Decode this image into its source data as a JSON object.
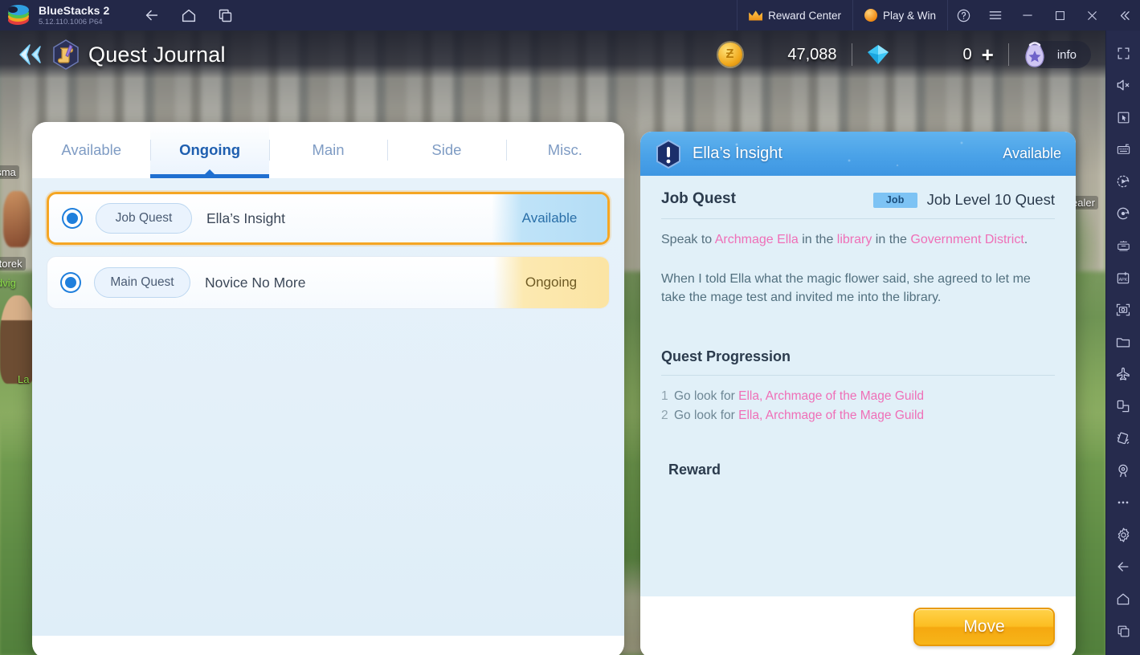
{
  "titlebar": {
    "app_name": "BlueStacks 2",
    "version": "5.12.110.1006  P64",
    "nav": [
      {
        "name": "back-icon",
        "label": "Back"
      },
      {
        "name": "home-icon",
        "label": "Home"
      },
      {
        "name": "multi-instance-icon",
        "label": "Multi-instance"
      }
    ],
    "reward_center": "Reward Center",
    "play_and_win": "Play & Win",
    "window_icons": [
      "help-icon",
      "menu-icon",
      "minimize-icon",
      "maximize-icon",
      "close-icon",
      "collapse-icon"
    ]
  },
  "game_header": {
    "title": "Quest Journal",
    "gold_value": "47,088",
    "gem_value": "0",
    "plus": "+",
    "info_label": "info"
  },
  "quest_list": {
    "tabs": [
      {
        "label": "Available",
        "active": false
      },
      {
        "label": "Ongoing",
        "active": true
      },
      {
        "label": "Main",
        "active": false
      },
      {
        "label": "Side",
        "active": false
      },
      {
        "label": "Misc.",
        "active": false
      }
    ],
    "rows": [
      {
        "tag": "Job Quest",
        "name": "Ella’s Insight",
        "status": "Available",
        "selected": true
      },
      {
        "tag": "Main Quest",
        "name": "Novice No More",
        "status": "Ongoing",
        "selected": false
      }
    ]
  },
  "detail": {
    "title": "Ella’s Insight",
    "status": "Available",
    "quest_kind": "Job Quest",
    "job_badge": "Job",
    "quest_level": "Job Level 10 Quest",
    "objective": {
      "p1": "Speak to ",
      "npc": "Archmage Ella",
      "p2": " in the ",
      "place": "library",
      "p3": " in the ",
      "district": "Government District",
      "p4": "."
    },
    "body": "When I told Ella what the magic flower said, she agreed to let me take the mage test and invited me into the library.",
    "progression_title": "Quest Progression",
    "progression": [
      {
        "n": "1",
        "text": "Go look for ",
        "target": "Ella, Archmage of the Mage Guild"
      },
      {
        "n": "2",
        "text": "Go look for ",
        "target": "Ella, Archmage of the Mage Guild"
      }
    ],
    "reward_title": "Reward",
    "move_button": "Move"
  },
  "sidebar": {
    "icons": [
      "fullscreen-icon",
      "mute-icon",
      "cursor-icon",
      "keyboard-controls-icon",
      "macro-record-icon",
      "screen-record-icon",
      "eco-mode-icon",
      "install-apk-icon",
      "screenshot-icon",
      "media-folder-icon",
      "airplane-icon",
      "rotate-icon",
      "shake-icon",
      "location-icon",
      "more-icon",
      "settings-icon",
      "back-icon",
      "home-icon",
      "recents-icon"
    ]
  },
  "background": {
    "npc_labels": [
      "ftsma",
      "Storek",
      "dvig",
      "La",
      "ealer"
    ]
  },
  "colors": {
    "accent_blue": "#1f6fd0",
    "header_blue": "#4aa2e8",
    "gold": "#f5a623",
    "pink": "#ef6fb7",
    "panel_bg": "#e1f0f8",
    "titlebar": "#232848"
  }
}
